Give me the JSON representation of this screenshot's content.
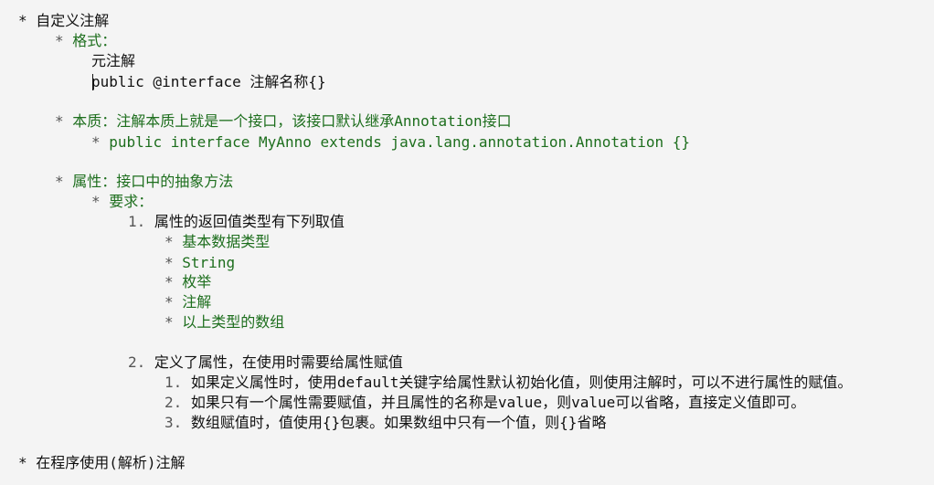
{
  "lines": [
    {
      "marker": "*",
      "text": "自定义注解",
      "color": "black"
    },
    {
      "marker": "*",
      "text": "格式：",
      "color": "green"
    },
    {
      "marker": "",
      "text": "元注解",
      "color": "black"
    },
    {
      "marker": "",
      "text": "public @interface 注解名称{}",
      "color": "black"
    },
    {
      "marker": "*",
      "text": "本质：注解本质上就是一个接口，该接口默认继承Annotation接口",
      "color": "green"
    },
    {
      "marker": "*",
      "text": "public interface MyAnno extends java.lang.annotation.Annotation {}",
      "color": "green"
    },
    {
      "marker": "*",
      "text": "属性：接口中的抽象方法",
      "color": "green"
    },
    {
      "marker": "*",
      "text": "要求：",
      "color": "green"
    },
    {
      "marker": "1.",
      "text": "属性的返回值类型有下列取值",
      "color": "black"
    },
    {
      "marker": "*",
      "text": "基本数据类型",
      "color": "green"
    },
    {
      "marker": "*",
      "text": "String",
      "color": "green"
    },
    {
      "marker": "*",
      "text": "枚举",
      "color": "green"
    },
    {
      "marker": "*",
      "text": "注解",
      "color": "green"
    },
    {
      "marker": "*",
      "text": "以上类型的数组",
      "color": "green"
    },
    {
      "marker": "2.",
      "text": "定义了属性，在使用时需要给属性赋值",
      "color": "black"
    },
    {
      "marker": "1.",
      "text": "如果定义属性时，使用default关键字给属性默认初始化值，则使用注解时，可以不进行属性的赋值。",
      "color": "black"
    },
    {
      "marker": "2.",
      "text": "如果只有一个属性需要赋值，并且属性的名称是value，则value可以省略，直接定义值即可。",
      "color": "black"
    },
    {
      "marker": "3.",
      "text": "数组赋值时，值使用{}包裹。如果数组中只有一个值，则{}省略",
      "color": "black"
    },
    {
      "marker": "*",
      "text": "在程序使用(解析)注解",
      "color": "black"
    }
  ]
}
